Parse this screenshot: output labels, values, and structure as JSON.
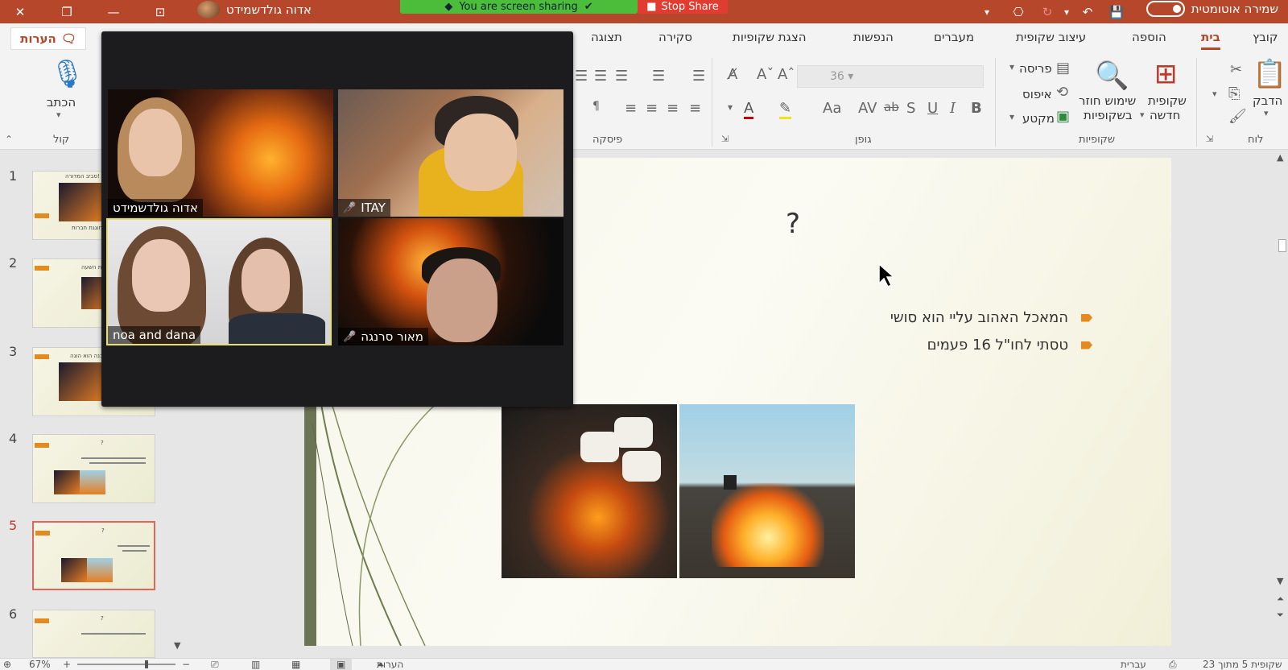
{
  "titlebar": {
    "owner_name": "אדוה גולדשמידט",
    "share_text": "You are screen sharing",
    "stop_share": "Stop Share",
    "autosave": "שמירה אוטומטית",
    "bg_color": "#b7472a"
  },
  "ribbon": {
    "tabs": [
      "קובץ",
      "בית",
      "הוספה",
      "עיצוב שקופית",
      "מעברים",
      "הנפשות",
      "הצגת שקופיות",
      "סקירה",
      "תצוגה"
    ],
    "active_tab": "בית",
    "notes_button": "הערות",
    "groups": {
      "clipboard": "לוח",
      "slides": "שקופיות",
      "font": "גופן",
      "paragraph": "פיסקה",
      "voice": "קול"
    },
    "buttons": {
      "paste": "הדבק",
      "new_slide_1": "שקופית",
      "new_slide_2": "חדשה",
      "reuse_1": "שימוש חוזר",
      "reuse_2": "בשקופיות",
      "layout": "פריסה",
      "reset": "איפוס",
      "section": "מקטע",
      "dictate": "הכתב"
    },
    "font_size": "36",
    "format_glyphs": {
      "bold": "B",
      "italic": "I",
      "underline": "U",
      "shadow": "S",
      "strike": "ab",
      "spacing": "AV",
      "case": "Aa",
      "font_color": "A"
    }
  },
  "thumbnails": {
    "numbers": [
      "1",
      "2",
      "3",
      "4",
      "5",
      "6"
    ],
    "active": "5",
    "snippets": {
      "t1_title": "סביב המדורה!",
      "t1_caption": "חוגגת חברות",
      "t2_title": "ר את השעה",
      "t3_title": "ם מבנה הוא הוגה!",
      "q": "?"
    }
  },
  "slide": {
    "title": "?",
    "bullets": [
      "המאכל האהוב עליי הוא סושי",
      "טסתי לחו\"ל 16 פעמים"
    ]
  },
  "zoom": {
    "participants": [
      {
        "name": "אדוה גולדשמידט",
        "muted": false
      },
      {
        "name": "ITAY",
        "muted": true
      },
      {
        "name": "noa and dana",
        "muted": false
      },
      {
        "name": "מאור סרנגה",
        "muted": true
      }
    ]
  },
  "statusbar": {
    "slide_counter": "שקופית 5 מתוך 23",
    "language": "עברית",
    "notes": "הערות",
    "zoom_level": "67%"
  },
  "colors": {
    "accent": "#b7472a",
    "bullet": "#e58a1f",
    "share_green": "#4bbd3b",
    "stop_red": "#e03c32"
  }
}
